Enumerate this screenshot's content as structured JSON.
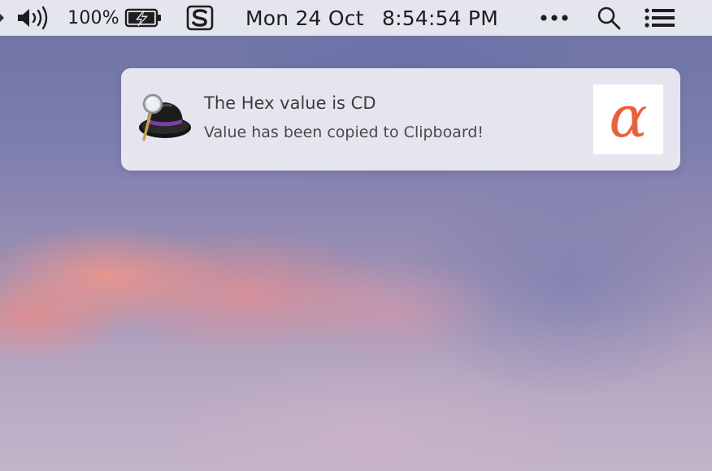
{
  "menubar": {
    "volume_icon": "speaker-volume-icon",
    "battery_percent": "100%",
    "battery_icon": "battery-charging-icon",
    "app_icon": "s-app-icon",
    "date": "Mon 24 Oct",
    "time": "8:54:54 PM",
    "more_icon": "ellipsis-icon",
    "search_icon": "spotlight-search-icon",
    "notification_center_icon": "list-icon"
  },
  "notification": {
    "app_icon": "alfred-hat-icon",
    "title": "The Hex value is CD",
    "body": "Value has been copied to Clipboard!",
    "content_image": {
      "glyph": "α",
      "color": "#e8613a"
    }
  },
  "colors": {
    "menubar_bg": "#e9eaf0",
    "notification_bg": "#ecebf2",
    "accent_purple": "#7b3fa6"
  }
}
